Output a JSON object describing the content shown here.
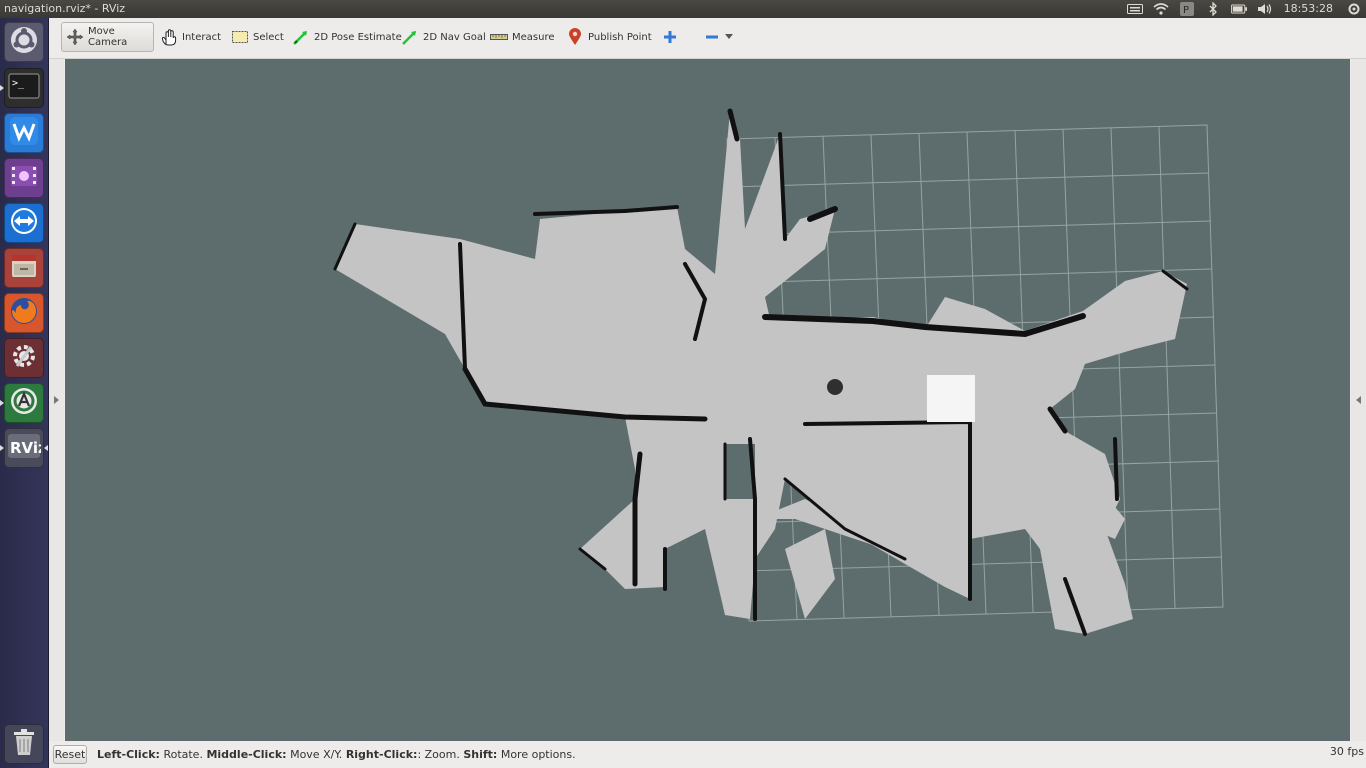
{
  "window": {
    "title": "navigation.rviz* - RViz"
  },
  "tray": {
    "clock": "18:53:28"
  },
  "launcher": {
    "items": [
      {
        "name": "ubuntu-dash",
        "icon": "ubuntu-logo-icon",
        "color": "#5b5a6e"
      },
      {
        "name": "terminal",
        "icon": "terminal-icon",
        "color": "#2e2e2e"
      },
      {
        "name": "wps-writer",
        "icon": "wps-writer-icon",
        "color": "#2a7bd6"
      },
      {
        "name": "video-player",
        "icon": "film-icon",
        "color": "#6e3f8e"
      },
      {
        "name": "teamviewer",
        "icon": "teamviewer-icon",
        "color": "#1a6fd1"
      },
      {
        "name": "file-manager",
        "icon": "file-cabinet-icon",
        "color": "#a8423a"
      },
      {
        "name": "firefox",
        "icon": "firefox-icon",
        "color": "#d8562b"
      },
      {
        "name": "system-settings",
        "icon": "settings-gear-icon",
        "color": "#6c2f33"
      },
      {
        "name": "software-updater",
        "icon": "updater-icon",
        "color": "#2c7a3e"
      },
      {
        "name": "rviz",
        "icon": "rviz-icon",
        "color": "#4a4b5a",
        "label": "RViz"
      },
      {
        "name": "trash",
        "icon": "trash-icon",
        "color": "#45465a"
      }
    ]
  },
  "toolbar": {
    "move_camera": "Move Camera",
    "interact": "Interact",
    "select": "Select",
    "pose_estimate": "2D Pose Estimate",
    "nav_goal": "2D Nav Goal",
    "measure": "Measure",
    "publish_point": "Publish Point"
  },
  "colors": {
    "viewport_bg": "#5d6d6d",
    "map_free": "#c4c4c4",
    "map_wall": "#111111",
    "grid": "#aab5b5",
    "pose_green": "#22c33a",
    "publish_point_red": "#c8412a"
  },
  "status": {
    "reset": "Reset",
    "hint_left_key": "Left-Click:",
    "hint_left_action": "Rotate.",
    "hint_middle_key": "Middle-Click:",
    "hint_middle_action": "Move X/Y.",
    "hint_right_key": "Right-Click:",
    "hint_right_action": ": Zoom.",
    "hint_shift_key": "Shift:",
    "hint_shift_action": "More options.",
    "fps": "30 fps"
  }
}
